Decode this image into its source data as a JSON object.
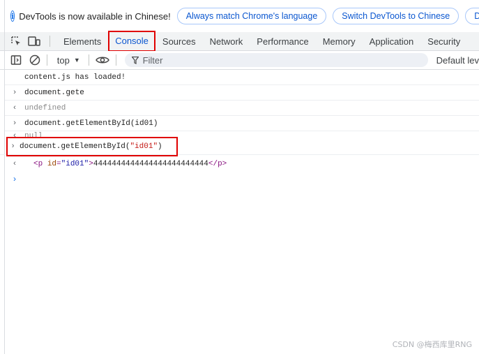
{
  "infobar": {
    "text": "DevTools is now available in Chinese!",
    "buttons": [
      "Always match Chrome's language",
      "Switch DevTools to Chinese",
      "Don"
    ]
  },
  "tabs": [
    "Elements",
    "Console",
    "Sources",
    "Network",
    "Performance",
    "Memory",
    "Application",
    "Security"
  ],
  "active_tab": "Console",
  "toolbar": {
    "context": "top",
    "filter_placeholder": "Filter",
    "levels": "Default lev"
  },
  "console": {
    "lines": [
      {
        "type": "log",
        "marker": "",
        "text": "content.js has loaded!"
      },
      {
        "type": "input",
        "marker": "›",
        "text": "document.gete"
      },
      {
        "type": "output",
        "marker": "‹",
        "text": "undefined"
      },
      {
        "type": "input",
        "marker": "›",
        "text": "document.getElementById(id01)"
      },
      {
        "type": "output",
        "marker": "‹",
        "text": "null"
      }
    ],
    "highlighted_input": {
      "marker": "›",
      "prefix": "document.getElementById(",
      "string": "\"id01\"",
      "suffix": ")"
    },
    "result": {
      "marker": "‹",
      "open_tag": "<p",
      "attr_name": "id",
      "eq": "=",
      "attr_value": "\"id01\"",
      "open_close": ">",
      "content": "4444444444444444444444444",
      "close_tag": "</p>"
    },
    "prompt_marker": "›"
  },
  "watermark": "CSDN @梅西库里RNG",
  "colors": {
    "accent": "#0b57d0",
    "highlight_border": "#e00000"
  }
}
